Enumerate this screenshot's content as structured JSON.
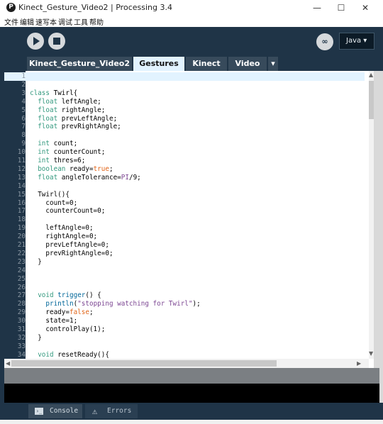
{
  "window": {
    "title": "Kinect_Gesture_Video2 | Processing 3.4",
    "app_icon_letter": "P",
    "minimize_symbol": "—",
    "maximize_symbol": "☐",
    "close_symbol": "✕"
  },
  "menu": [
    "文件",
    "编辑",
    "速写本",
    "调试",
    "工具",
    "帮助"
  ],
  "toolbar": {
    "run_icon": "play-icon",
    "stop_icon": "stop-icon",
    "mode_button_label": "∞",
    "mode_selector_label": "Java ▾"
  },
  "tabs": [
    "Kinect_Gesture_Video2",
    "Gestures",
    "Kinect",
    "Video"
  ],
  "tab_overflow_symbol": "▾",
  "active_tab": "Gestures",
  "code_lines": [
    {
      "n": "1",
      "current": true,
      "tokens": []
    },
    {
      "n": "2",
      "tokens": []
    },
    {
      "n": "3",
      "tokens": [
        {
          "t": "class",
          "c": "kw"
        },
        {
          "t": " Twirl{"
        }
      ]
    },
    {
      "n": "4",
      "tokens": [
        {
          "t": "  "
        },
        {
          "t": "float",
          "c": "kw"
        },
        {
          "t": " leftAngle;"
        }
      ]
    },
    {
      "n": "5",
      "tokens": [
        {
          "t": "  "
        },
        {
          "t": "float",
          "c": "kw"
        },
        {
          "t": " rightAngle;"
        }
      ]
    },
    {
      "n": "6",
      "tokens": [
        {
          "t": "  "
        },
        {
          "t": "float",
          "c": "kw"
        },
        {
          "t": " prevLeftAngle;"
        }
      ]
    },
    {
      "n": "7",
      "tokens": [
        {
          "t": "  "
        },
        {
          "t": "float",
          "c": "kw"
        },
        {
          "t": " prevRightAngle;"
        }
      ]
    },
    {
      "n": "8",
      "tokens": []
    },
    {
      "n": "9",
      "tokens": [
        {
          "t": "  "
        },
        {
          "t": "int",
          "c": "kw"
        },
        {
          "t": " count;"
        }
      ]
    },
    {
      "n": "10",
      "tokens": [
        {
          "t": "  "
        },
        {
          "t": "int",
          "c": "kw"
        },
        {
          "t": " counterCount;"
        }
      ]
    },
    {
      "n": "11",
      "tokens": [
        {
          "t": "  "
        },
        {
          "t": "int",
          "c": "kw"
        },
        {
          "t": " thres=6;"
        }
      ]
    },
    {
      "n": "12",
      "tokens": [
        {
          "t": "  "
        },
        {
          "t": "boolean",
          "c": "kw"
        },
        {
          "t": " ready="
        },
        {
          "t": "true",
          "c": "ty"
        },
        {
          "t": ";"
        }
      ]
    },
    {
      "n": "13",
      "tokens": [
        {
          "t": "  "
        },
        {
          "t": "float",
          "c": "kw"
        },
        {
          "t": " angleTolerance="
        },
        {
          "t": "PI",
          "c": "st"
        },
        {
          "t": "/9;"
        }
      ]
    },
    {
      "n": "14",
      "tokens": []
    },
    {
      "n": "15",
      "tokens": [
        {
          "t": "  Twirl(){"
        }
      ]
    },
    {
      "n": "16",
      "tokens": [
        {
          "t": "    count=0;"
        }
      ]
    },
    {
      "n": "17",
      "tokens": [
        {
          "t": "    counterCount=0;"
        }
      ]
    },
    {
      "n": "18",
      "tokens": []
    },
    {
      "n": "19",
      "tokens": [
        {
          "t": "    leftAngle=0;"
        }
      ]
    },
    {
      "n": "20",
      "tokens": [
        {
          "t": "    rightAngle=0;"
        }
      ]
    },
    {
      "n": "21",
      "tokens": [
        {
          "t": "    prevLeftAngle=0;"
        }
      ]
    },
    {
      "n": "22",
      "tokens": [
        {
          "t": "    prevRightAngle=0;"
        }
      ]
    },
    {
      "n": "23",
      "tokens": [
        {
          "t": "  }"
        }
      ]
    },
    {
      "n": "24",
      "tokens": []
    },
    {
      "n": "25",
      "tokens": []
    },
    {
      "n": "26",
      "tokens": []
    },
    {
      "n": "27",
      "tokens": [
        {
          "t": "  "
        },
        {
          "t": "void",
          "c": "kw"
        },
        {
          "t": " "
        },
        {
          "t": "trigger",
          "c": "fn"
        },
        {
          "t": "() {"
        }
      ]
    },
    {
      "n": "28",
      "tokens": [
        {
          "t": "    "
        },
        {
          "t": "println",
          "c": "fn"
        },
        {
          "t": "("
        },
        {
          "t": "\"stopping watching for Twirl\"",
          "c": "st"
        },
        {
          "t": ");"
        }
      ]
    },
    {
      "n": "29",
      "tokens": [
        {
          "t": "    ready="
        },
        {
          "t": "false",
          "c": "ty"
        },
        {
          "t": ";"
        }
      ]
    },
    {
      "n": "30",
      "tokens": [
        {
          "t": "    state=1;"
        }
      ]
    },
    {
      "n": "31",
      "tokens": [
        {
          "t": "    controlPlay(1);"
        }
      ]
    },
    {
      "n": "32",
      "tokens": [
        {
          "t": "  }"
        }
      ]
    },
    {
      "n": "33",
      "tokens": []
    },
    {
      "n": "34",
      "tokens": [
        {
          "t": "  "
        },
        {
          "t": "void",
          "c": "kw"
        },
        {
          "t": " resetReady(){"
        }
      ]
    }
  ],
  "footer": {
    "console_label": "Console",
    "errors_label": "Errors"
  },
  "colors": {
    "ide_chrome": "#1f3447",
    "active_tab": "#e2f3ff",
    "keyword": "#33997e"
  }
}
